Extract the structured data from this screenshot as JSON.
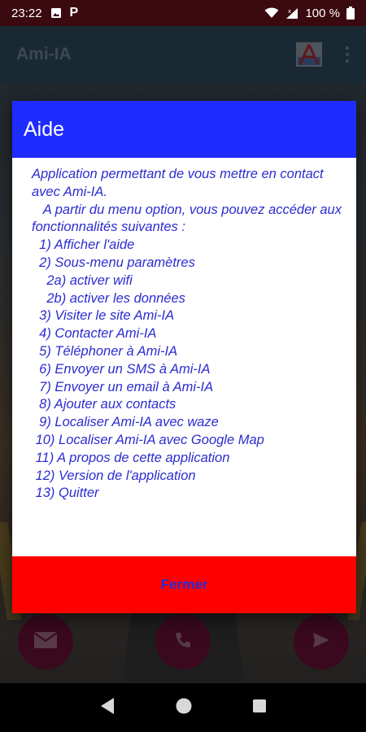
{
  "status_bar": {
    "time": "23:22",
    "battery": "100 %",
    "icons": [
      "photo-icon",
      "parking-icon",
      "wifi-icon",
      "signal-icon",
      "battery-icon"
    ],
    "parking_glyph": "P"
  },
  "app_bar": {
    "title": "Ami-IA",
    "icons": [
      "app-logo-icon",
      "overflow-menu-icon"
    ]
  },
  "dialog": {
    "title": "Aide",
    "intro_line1": "Application permettant de vous mettre en contact avec Ami-IA.",
    "intro_line2": "   A partir du menu option, vous pouvez accéder aux fonctionnalités suivantes :",
    "items": [
      "  1) Afficher l'aide",
      "  2) Sous-menu paramètres",
      "    2a) activer wifi",
      "    2b) activer les données",
      "  3) Visiter le site Ami-IA",
      "  4) Contacter Ami-IA",
      "  5) Téléphoner à Ami-IA",
      "  6) Envoyer un SMS à Ami-IA",
      "  7) Envoyer un email à Ami-IA",
      "  8) Ajouter aux contacts",
      "  9) Localiser Ami-IA avec waze",
      " 10) Localiser Ami-IA avec Google Map",
      " 11) A propos de cette application",
      " 12) Version de l'application",
      " 13) Quitter"
    ],
    "close_label": "Fermer"
  },
  "fabs": [
    "mail-icon",
    "phone-icon",
    "send-icon"
  ],
  "nav": [
    "back-icon",
    "home-icon",
    "recents-icon"
  ],
  "colors": {
    "status_bar": "#3a0a10",
    "app_bar": "#2f4b5e",
    "dialog_header": "#1f2cff",
    "dialog_text": "#2c2cd0",
    "dialog_footer": "#ff0000",
    "fab": "#6b1238"
  }
}
